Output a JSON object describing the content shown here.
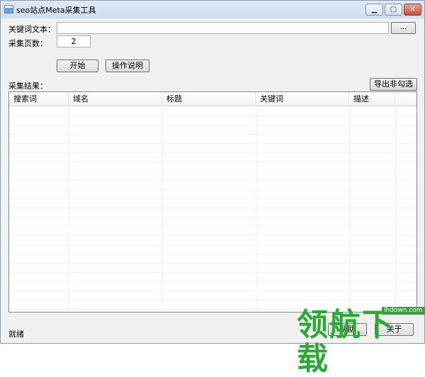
{
  "window": {
    "title": "seo站点Meta采集工具",
    "min_label": "▁",
    "max_label": "▢",
    "close_label": "✕"
  },
  "form": {
    "keyword_label": "关键词文本：",
    "keyword_value": "",
    "browse_label": "...",
    "pages_label": "采集页数：",
    "pages_value": "2"
  },
  "actions": {
    "start_label": "开始",
    "help_label": "操作说明",
    "export_label": "导出非勾选"
  },
  "results": {
    "title": "采集结果：",
    "columns": [
      "搜索词",
      "域名",
      "标题",
      "关键词",
      "描述"
    ],
    "rows": []
  },
  "footer": {
    "status": "就绪",
    "btn1_label": "帮助",
    "btn2_label": "关于"
  },
  "watermark": {
    "text": "领航下载",
    "url": "lhdown.com"
  },
  "colors": {
    "watermark_green": "#2fa83a",
    "window_bg": "#f0f0f0"
  }
}
